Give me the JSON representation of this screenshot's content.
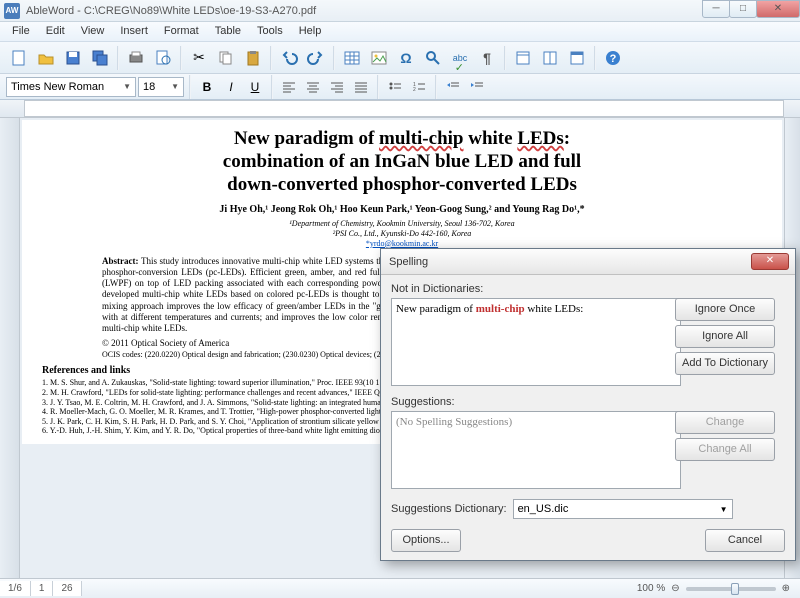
{
  "window": {
    "app_initials": "AW",
    "title": "AbleWord - C:\\CREG\\No89\\White LEDs\\oe-19-S3-A270.pdf"
  },
  "menu": [
    "File",
    "Edit",
    "View",
    "Insert",
    "Format",
    "Table",
    "Tools",
    "Help"
  ],
  "formatbar": {
    "font_name": "Times New Roman",
    "font_size": "18"
  },
  "document": {
    "title_line1": "New paradigm of multi-chip white LEDs:",
    "title_line2": "combination of an InGaN blue LED and full",
    "title_line3": "down-converted phosphor-converted LEDs",
    "title_wavy": "multi-chip",
    "authors": "Ji Hye Oh,¹ Jeong Rok Oh,¹ Hoo Keun Park,¹ Yeon-Goog Sung,² and Young Rag Do¹,*",
    "affil1": "¹Department of Chemistry, Kookmin University, Seoul 136-702, Korea",
    "affil2": "²PSI Co., Ltd., Kyunski-Do 442-160, Korea",
    "email": "*yrdo@kookmin.ac.kr",
    "abstract_label": "Abstract:",
    "abstract_text": "This study introduces innovative multi-chip white LED systems that combine an InGaN blue LED and green/red or green/amber/red full down-converted, phosphor-conversion LEDs (pc-LEDs). Efficient green, amber, and red full down-converted pc-LEDs were fabricated by simply capping a long-wave pass filter (LWPF) on top of LED packing associated with each corresponding powder phosphor. The principal advantage of this type of color-mixing approach in newly developed multi-chip white LEDs based on colored pc-LEDs is thought to be dynamic control of the chromaticity and better light quality. In addition, the color-mixing approach improves the low efficacy of green/amber LEDs in the \"green gap\" wavelength; reduces the wide color/efficacy variations of each primary LED with at different temperatures and currents; and improves the low color rendering indexes of the traditional color-mixing approach in red, green, and blue (RGB) multi-chip white LEDs.",
    "copyright": "© 2011 Optical Society of America",
    "ocis": "OCIS codes: (220.0220) Optical design and fabrication; (230.0230) Optical devices; (230.14 Bragg reflectors; (230.3670) Light-emitting diodes.",
    "refs_heading": "References and links",
    "refs": [
      "1. M. S. Shur, and A. Zukauskas, \"Solid-state lighting: toward superior illumination,\" Proc. IEEE 93(10 1703 (2005).",
      "2. M. H. Crawford, \"LEDs for solid-state lighting: performance challenges and recent advances,\" IEEE Quantum Electron. 15(4), 1028–1040 (2009).",
      "3. J. Y. Tsao, M. E. Coltrin, M. H. Crawford, and J. A. Simmons, \"Solid-state lighting: an integrated human factors, technology, and economic perspective,\" Proc. IEEE 98(7), 1162–1179 (2010).",
      "4. R. Moeller-Mach, G. O. Moeller, M. R. Krames, and T. Trottier, \"High-power phosphor-converted light-emitting diodes based on III-Nitrides,\" IEEE J. Sel. Top. Quantum Electron. 8(2), 339–345 (2002).",
      "5. J. K. Park, C. H. Kim, S. H. Park, H. D. Park, and S. Y. Choi, \"Application of strontium silicate yellow phosphor for white light-emitting diodes,\" Appl. Phys. Lett. 84(10), 1647–1649 (2004).",
      "6. Y.-D. Huh, J.-H. Shim, Y. Kim, and Y. R. Do, \"Optical properties of three-band white light emitting diodes,\" J."
    ]
  },
  "statusbar": {
    "pages": [
      "1/6",
      "1",
      "26"
    ],
    "zoom": "100 %"
  },
  "dialog": {
    "title": "Spelling",
    "not_in_dict_label": "Not in Dictionaries:",
    "context_pre": "New paradigm of ",
    "context_word": "multi-chip",
    "context_post": " white LEDs:",
    "suggestions_label": "Suggestions:",
    "no_suggestions": "(No Spelling Suggestions)",
    "dict_label": "Suggestions Dictionary:",
    "dict_value": "en_US.dic",
    "buttons": {
      "ignore_once": "Ignore Once",
      "ignore_all": "Ignore All",
      "add": "Add To Dictionary",
      "change": "Change",
      "change_all": "Change All",
      "options": "Options...",
      "cancel": "Cancel"
    }
  }
}
